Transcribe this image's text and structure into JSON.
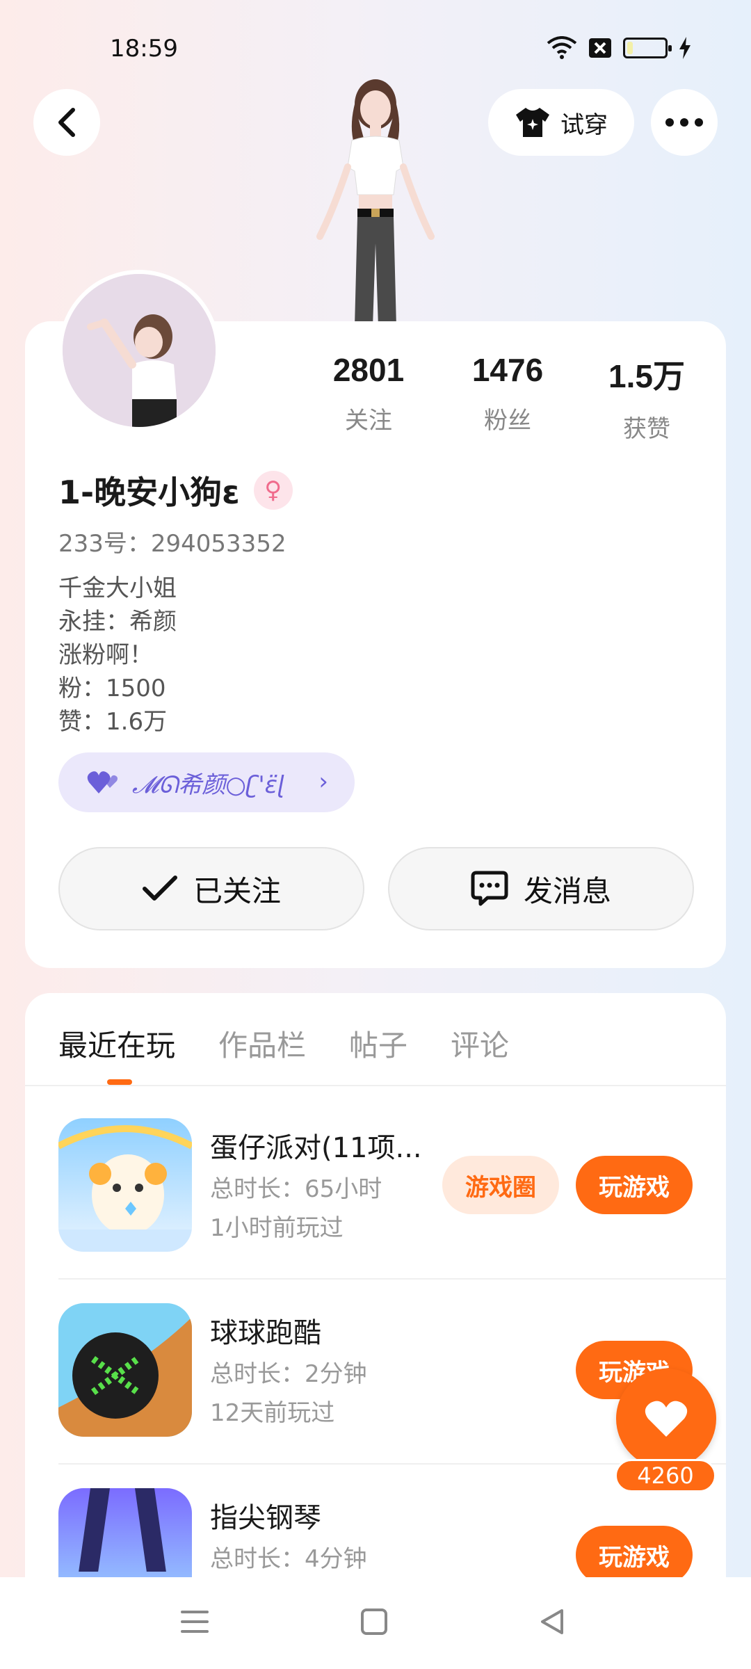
{
  "status_bar": {
    "time": "18:59",
    "battery_level": 0.15
  },
  "header": {
    "tryon_label": "试穿"
  },
  "profile": {
    "stats": [
      {
        "value": "2801",
        "label": "关注"
      },
      {
        "value": "1476",
        "label": "粉丝"
      },
      {
        "value": "1.5万",
        "label": "获赞"
      }
    ],
    "username": "1-晚安小狗ε",
    "uid": "233号：294053352",
    "bio": [
      "千金大小姐",
      "永挂：希颜",
      "涨粉啊！",
      "粉：1500",
      "赞：1.6万"
    ],
    "tag_text": "𝓜ᘏ希颜○ʗ'ε̈ɭ",
    "follow_label": "已关注",
    "message_label": "发消息"
  },
  "tabs": [
    {
      "label": "最近在玩",
      "active": true
    },
    {
      "label": "作品栏",
      "active": false
    },
    {
      "label": "帖子",
      "active": false
    },
    {
      "label": "评论",
      "active": false
    }
  ],
  "games": [
    {
      "title": "蛋仔派对(11项...",
      "duration": "总时长：65小时",
      "last_played": "1小时前玩过",
      "circle_label": "游戏圈",
      "play_label": "玩游戏"
    },
    {
      "title": "球球跑酷",
      "duration": "总时长：2分钟",
      "last_played": "12天前玩过",
      "play_label": "玩游戏"
    },
    {
      "title": "指尖钢琴",
      "duration": "总时长：4分钟",
      "play_label": "玩游戏"
    }
  ],
  "like_fab": {
    "count": "4260"
  },
  "colors": {
    "accent": "#ff6a13",
    "tag_purple": "#6b5fd9"
  },
  "icons": [
    "back-arrow-icon",
    "tshirt-icon",
    "more-dots-icon",
    "check-icon",
    "chat-bubble-icon",
    "heart-icon",
    "wifi-icon",
    "sim-icon",
    "battery-icon",
    "charging-icon",
    "menu-icon",
    "home-square-icon",
    "back-triangle-icon"
  ]
}
